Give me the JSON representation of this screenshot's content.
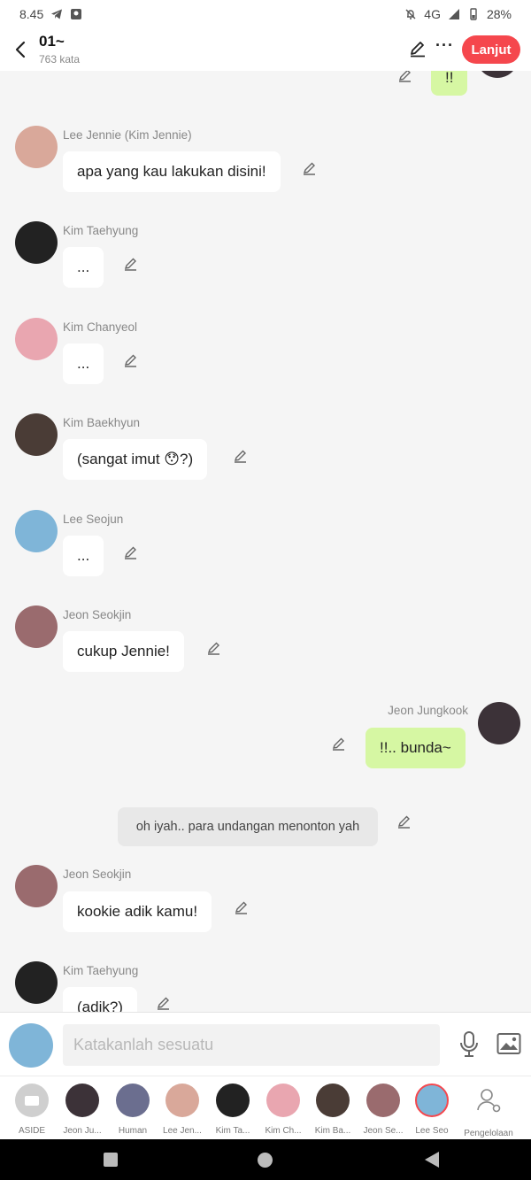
{
  "status_bar": {
    "time": "8.45",
    "network": "4G",
    "battery": "28%"
  },
  "header": {
    "title": "01~",
    "subtitle": "763 kata",
    "next_label": "Lanjut",
    "more_label": "···"
  },
  "top_partial_message": {
    "text": "!!"
  },
  "messages": [
    {
      "name": "Lee Jennie (Kim Jennie)",
      "text": "apa yang kau lakukan disini!",
      "avatar_color": "#d9a89a"
    },
    {
      "name": "Kim Taehyung",
      "text": "...",
      "avatar_color": "#222222"
    },
    {
      "name": "Kim Chanyeol",
      "text": "...",
      "avatar_color": "#e9a6b0"
    },
    {
      "name": "Kim Baekhyun",
      "text": "(sangat imut 😯?)",
      "avatar_color": "#4a3c36"
    },
    {
      "name": "Lee Seojun",
      "text": "...",
      "avatar_color": "#7fb5d8"
    },
    {
      "name": "Jeon Seokjin",
      "text": "cukup Jennie!",
      "avatar_color": "#9a6b6e"
    },
    {
      "name": "Jeon Jungkook",
      "text": "!!.. bunda~",
      "avatar_color": "#3c3238"
    },
    {
      "name": "Jeon Seokjin",
      "text": "kookie adik kamu!",
      "avatar_color": "#9a6b6e"
    },
    {
      "name": "Kim Taehyung",
      "text": "(adik?)",
      "avatar_color": "#222222"
    }
  ],
  "narration": {
    "text": "oh iyah.. para undangan menonton yah"
  },
  "input": {
    "placeholder": "Katakanlah sesuatu"
  },
  "characters": [
    {
      "label": "ASIDE",
      "color": "#cfcfcf"
    },
    {
      "label": "Jeon Ju...",
      "color": "#3c3238"
    },
    {
      "label": "Human",
      "color": "#6b6e8f"
    },
    {
      "label": "Lee Jen...",
      "color": "#d9a89a"
    },
    {
      "label": "Kim Ta...",
      "color": "#222222"
    },
    {
      "label": "Kim Ch...",
      "color": "#e9a6b0"
    },
    {
      "label": "Kim Ba...",
      "color": "#4a3c36"
    },
    {
      "label": "Jeon Se...",
      "color": "#9a6b6e"
    },
    {
      "label": "Lee Seo",
      "color": "#7fb5d8"
    },
    {
      "label": "Pengelolaan",
      "color": "#ffffff"
    }
  ],
  "colors": {
    "accent": "#f5474d",
    "my_bubble": "#d6f7a3"
  }
}
